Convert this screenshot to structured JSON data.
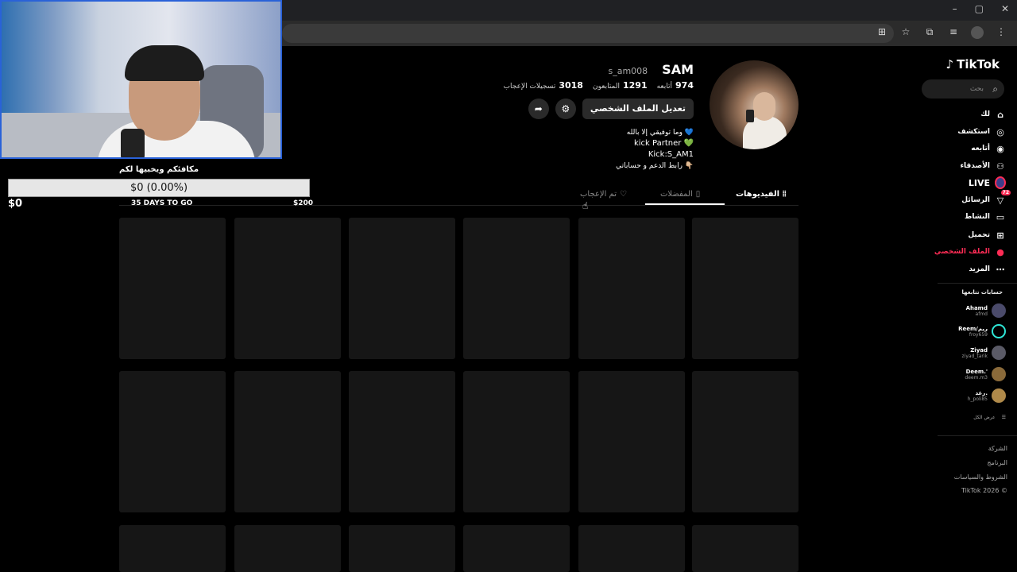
{
  "window": {
    "controls": [
      "–",
      "▢",
      "✕"
    ]
  },
  "overlay": {
    "goal_title": "مكافئكم ويخبيها لكم",
    "goal_bar_text": "$0 (0.00%)",
    "goal_current": "$0",
    "goal_days": "35 DAYS TO GO",
    "goal_target": "$200",
    "goal_progress": 0.0
  },
  "sidebar": {
    "logo": "TikTok",
    "search_placeholder": "بحث",
    "nav": [
      {
        "label": "لك",
        "icon": "home-icon"
      },
      {
        "label": "استكشف",
        "icon": "compass-icon"
      },
      {
        "label": "أتابعه",
        "icon": "following-icon"
      },
      {
        "label": "الأصدقاء",
        "icon": "friends-icon"
      },
      {
        "label": "LIVE",
        "icon": "live-icon"
      },
      {
        "label": "الرسائل",
        "icon": "messages-icon",
        "badge": "72"
      },
      {
        "label": "النشاط",
        "icon": "activity-icon"
      },
      {
        "label": "تحميل",
        "icon": "upload-icon"
      },
      {
        "label": "الملف الشخصي",
        "icon": "profile-icon",
        "active": true
      },
      {
        "label": "المزيد",
        "icon": "more-icon"
      }
    ],
    "following_heading": "حسابات تتابعها",
    "accounts": [
      {
        "name": "Ahamd",
        "handle": "afmd"
      },
      {
        "name": "Reem/ريم",
        "handle": "froy659"
      },
      {
        "name": "Ziyad",
        "handle": "ziyad_tarik"
      },
      {
        "name": "Deem.'",
        "handle": "deem.m3"
      },
      {
        "name": "رغد.",
        "handle": "h_poli85"
      }
    ],
    "see_all": "عرض الكل",
    "footer": [
      "الشركة",
      "البرنامج",
      "الشروط والسياسات",
      "TikTok 2026 ©"
    ]
  },
  "profile": {
    "display_name": "SAM",
    "handle": "s_am008",
    "stats": [
      {
        "label": "أتابعه",
        "value": "974"
      },
      {
        "label": "المتابعون",
        "value": "1291"
      },
      {
        "label": "تسجيلات الإعجاب",
        "value": "3018"
      }
    ],
    "edit_button": "تعديل الملف الشخصي",
    "bio": [
      "وما توفيقي إلا بالله 💙",
      "kick Partner 💚",
      "Kick:S_AM1",
      "رابط الدعم و حساباتي 👇🏼"
    ]
  },
  "tabs": [
    {
      "label": "الفيديوهات",
      "icon": "grid-icon",
      "active": true
    },
    {
      "label": "المفضلات",
      "icon": "bookmark-icon"
    },
    {
      "label": "تم الإعجاب",
      "icon": "heart-icon"
    }
  ],
  "colors": {
    "accent": "#fe2c55",
    "background": "#000000",
    "tile": "#161616"
  }
}
